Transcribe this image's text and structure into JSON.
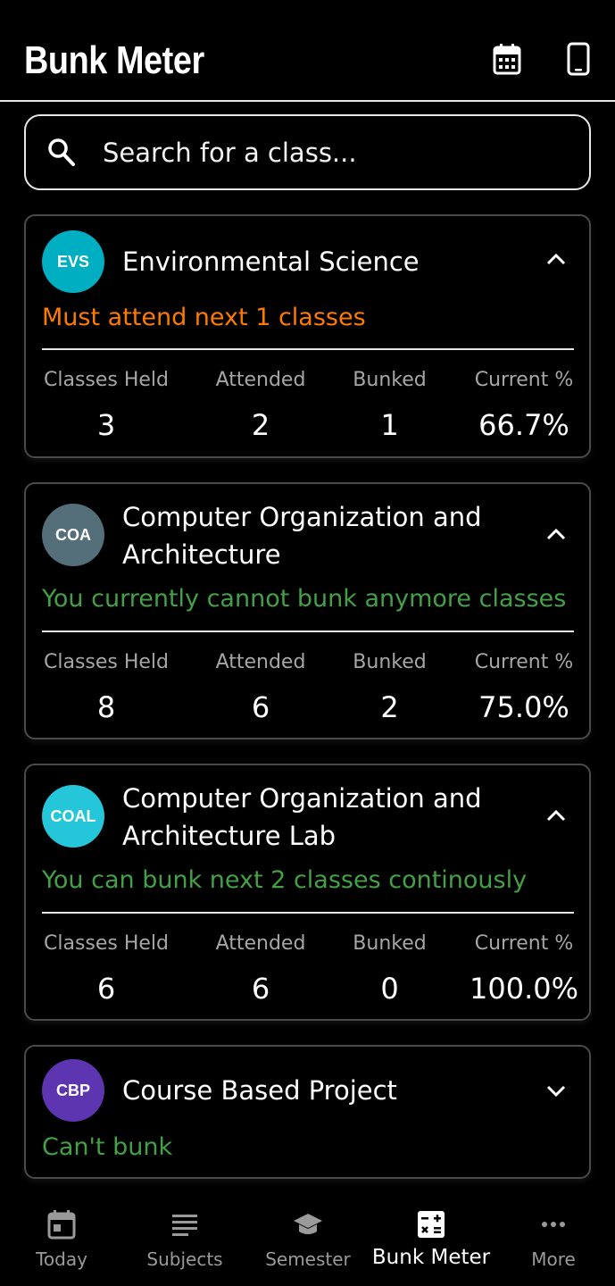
{
  "header": {
    "title": "Bunk Meter",
    "calendar_icon": "calendar-icon",
    "device_icon": "smartphone-icon"
  },
  "search": {
    "placeholder": "Search for a class...",
    "icon": "search-icon"
  },
  "stat_labels": {
    "held": "Classes Held",
    "attended": "Attended",
    "bunked": "Bunked",
    "current": "Current %"
  },
  "subjects": [
    {
      "code": "EVS",
      "name": "Environmental Science",
      "status": "Must attend next 1 classes",
      "status_color": "#ff7a00",
      "avatar_color": "#00aec2",
      "expanded": true,
      "held": "3",
      "attended": "2",
      "bunked": "1",
      "current": "66.7%"
    },
    {
      "code": "COA",
      "name": "Computer Organization and Architecture",
      "status": "You currently cannot bunk anymore classes",
      "status_color": "#43a047",
      "avatar_color": "#546e7a",
      "expanded": true,
      "held": "8",
      "attended": "6",
      "bunked": "2",
      "current": "75.0%"
    },
    {
      "code": "COAL",
      "name": "Computer Organization and Architecture Lab",
      "status": "You can bunk next 2 classes continously",
      "status_color": "#43a047",
      "avatar_color": "#26c6da",
      "expanded": true,
      "held": "6",
      "attended": "6",
      "bunked": "0",
      "current": "100.0%"
    },
    {
      "code": "CBP",
      "name": "Course Based Project",
      "status": "Can't bunk",
      "status_color": "#43a047",
      "avatar_color": "#5e35b1",
      "expanded": false
    }
  ],
  "nav": {
    "items": [
      {
        "label": "Today",
        "icon": "today-icon"
      },
      {
        "label": "Subjects",
        "icon": "subjects-icon"
      },
      {
        "label": "Semester",
        "icon": "graduation-cap-icon"
      },
      {
        "label": "Bunk Meter",
        "icon": "calculator-icon",
        "active": true
      },
      {
        "label": "More",
        "icon": "more-dots-icon"
      }
    ]
  }
}
